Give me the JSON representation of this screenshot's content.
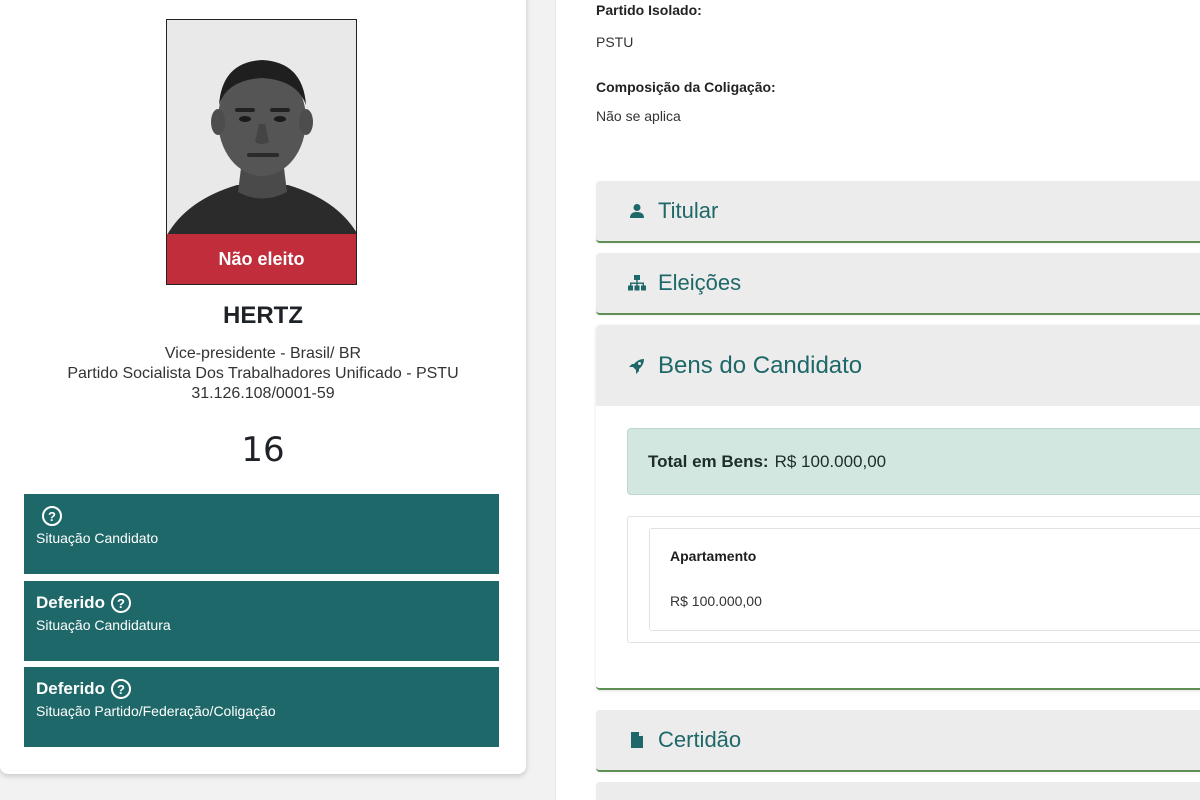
{
  "profile": {
    "status_ribbon": "Não eleito",
    "name": "HERTZ",
    "role": "Vice-presidente - Brasil/ BR",
    "party": "Partido Socialista Dos Trabalhadores Unificado - PSTU",
    "cnpj": "31.126.108/0001-59",
    "number": "16",
    "situations": [
      {
        "value": "",
        "label": "Situação Candidato"
      },
      {
        "value": "Deferido",
        "label": "Situação Candidatura"
      },
      {
        "value": "Deferido",
        "label": "Situação Partido/Federação/Coligação"
      }
    ],
    "help_glyph": "?",
    "colors": {
      "situation_bg": "#1f6869",
      "ribbon": "#d62d3c"
    }
  },
  "details": {
    "party_label": "Partido Isolado:",
    "party_value": "PSTU",
    "coalition_label": "Composição da Coligação:",
    "coalition_value": "Não se aplica"
  },
  "sections": {
    "titular": {
      "label": "Titular",
      "icon": "user-icon"
    },
    "eleicoes": {
      "label": "Eleições",
      "icon": "sitemap-icon"
    },
    "bens": {
      "label": "Bens do Candidato",
      "icon": "rocket-icon",
      "total_label": "Total em Bens:",
      "total_value": "R$ 100.000,00",
      "items": [
        {
          "name": "Apartamento",
          "value": "R$ 100.000,00"
        }
      ]
    },
    "certidao": {
      "label": "Certidão",
      "icon": "file-icon"
    }
  },
  "colors": {
    "accent": "#1f6869",
    "accordion_border": "#5f8f55",
    "total_bg": "#d2e7df"
  }
}
